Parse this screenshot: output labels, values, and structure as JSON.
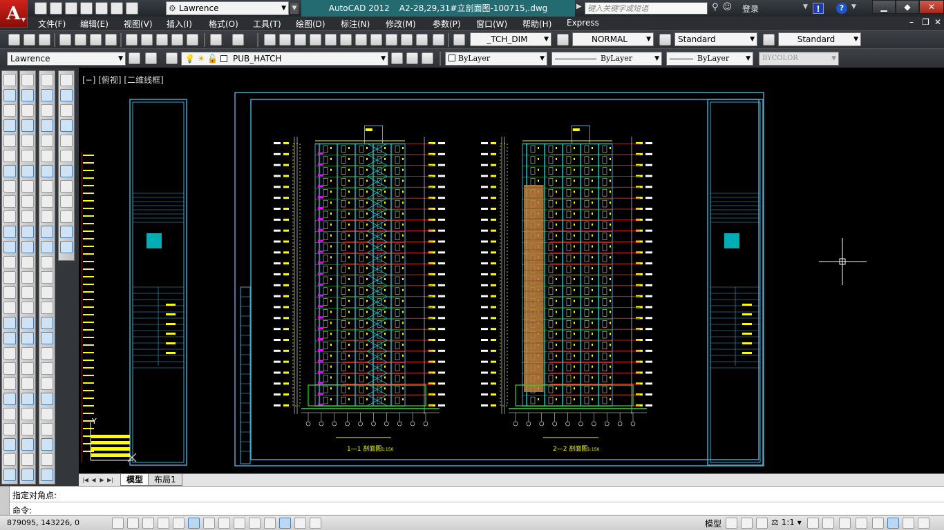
{
  "titlebar": {
    "workspace": "Lawrence",
    "app_name": "AutoCAD 2012",
    "file_name": "A2-28,29,31#立剖面图-100715,.dwg",
    "search_placeholder": "键入关键字或短语",
    "login_label": "登录"
  },
  "menu": [
    "文件(F)",
    "编辑(E)",
    "视图(V)",
    "插入(I)",
    "格式(O)",
    "工具(T)",
    "绘图(D)",
    "标注(N)",
    "修改(M)",
    "参数(P)",
    "窗口(W)",
    "帮助(H)",
    "Express"
  ],
  "toolbar": {
    "dim_style": "_TCH_DIM",
    "text_style": "NORMAL",
    "table_style": "Standard",
    "mleader_style": "Standard",
    "layer_state": "Lawrence",
    "current_layer": "PUB_HATCH",
    "color": "ByLayer",
    "linetype": "ByLayer",
    "lineweight": "ByLayer",
    "plot_style": "BYCOLOR"
  },
  "viewport": {
    "label": "[−] [俯视] [二维线框]"
  },
  "drawing": {
    "section1_caption": "1—1 剖面图",
    "section1_scale": "1:150",
    "section2_caption": "2—2 剖面图",
    "section2_scale": "1:150",
    "colors": {
      "frame": "#3fa9d6",
      "yellow": "#ffff00",
      "red": "#ff2020",
      "cyan": "#00d8e0",
      "magenta": "#ff00ff",
      "green": "#30e030",
      "brown": "#c08040"
    }
  },
  "layout_tabs": [
    "模型",
    "布局1"
  ],
  "command": {
    "history": "指定对角点:",
    "prompt": "命令:"
  },
  "status": {
    "coords": "879095, 143226, 0",
    "model_label": "模型",
    "scale_label": "1:1"
  },
  "icons": [
    "autocad-logo-icon",
    "new-icon",
    "open-icon",
    "save-icon",
    "print-icon",
    "undo-icon",
    "redo-icon",
    "binoculars-icon",
    "user-icon",
    "exchange-icon",
    "help-icon",
    "pan-icon",
    "zoom-icon",
    "layer-icon",
    "crosshair-cursor-icon",
    "ucs-icon"
  ]
}
